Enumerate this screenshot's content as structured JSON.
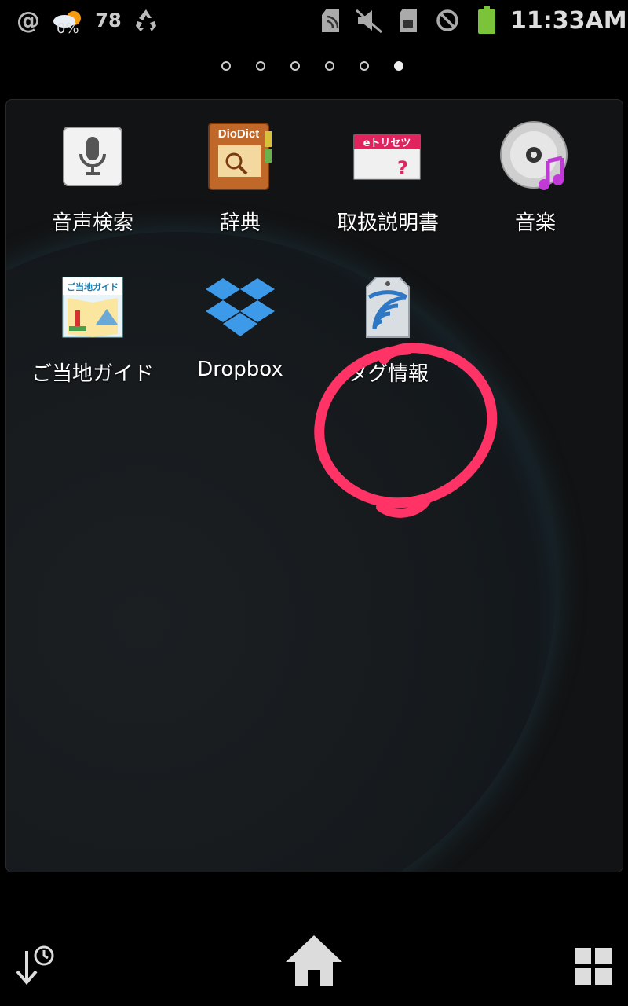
{
  "status_bar": {
    "icons": [
      "at-icon",
      "weather-icon",
      "recycle-icon",
      "nfc-icon",
      "mute-icon",
      "sd-card-icon",
      "no-signal-icon",
      "battery-icon"
    ],
    "weather_percent": "0%",
    "temperature": "78",
    "time": "11:33AM",
    "battery_color": "#7bc43a"
  },
  "pages": {
    "count": 6,
    "active": 6
  },
  "apps": [
    {
      "label": "音声検索",
      "icon": "voice-search-icon"
    },
    {
      "label": "辞典",
      "icon": "dictionary-icon"
    },
    {
      "label": "取扱説明書",
      "icon": "manual-icon"
    },
    {
      "label": "音楽",
      "icon": "music-icon"
    },
    {
      "label": "ご当地ガイド",
      "icon": "local-guide-icon"
    },
    {
      "label": "Dropbox",
      "icon": "dropbox-icon"
    },
    {
      "label": "タグ情報",
      "icon": "tag-info-icon"
    }
  ],
  "icon_text": {
    "dictionary_title": "DioDict",
    "manual_title": "eトリセツ",
    "guide_title": "ご当地ガイド"
  },
  "annotation": {
    "color": "#ff3366",
    "shape": "hand-drawn circle around タグ情報"
  },
  "bottom_bar": {
    "icons": [
      "recent-icon",
      "home-icon",
      "apps-grid-icon"
    ]
  }
}
